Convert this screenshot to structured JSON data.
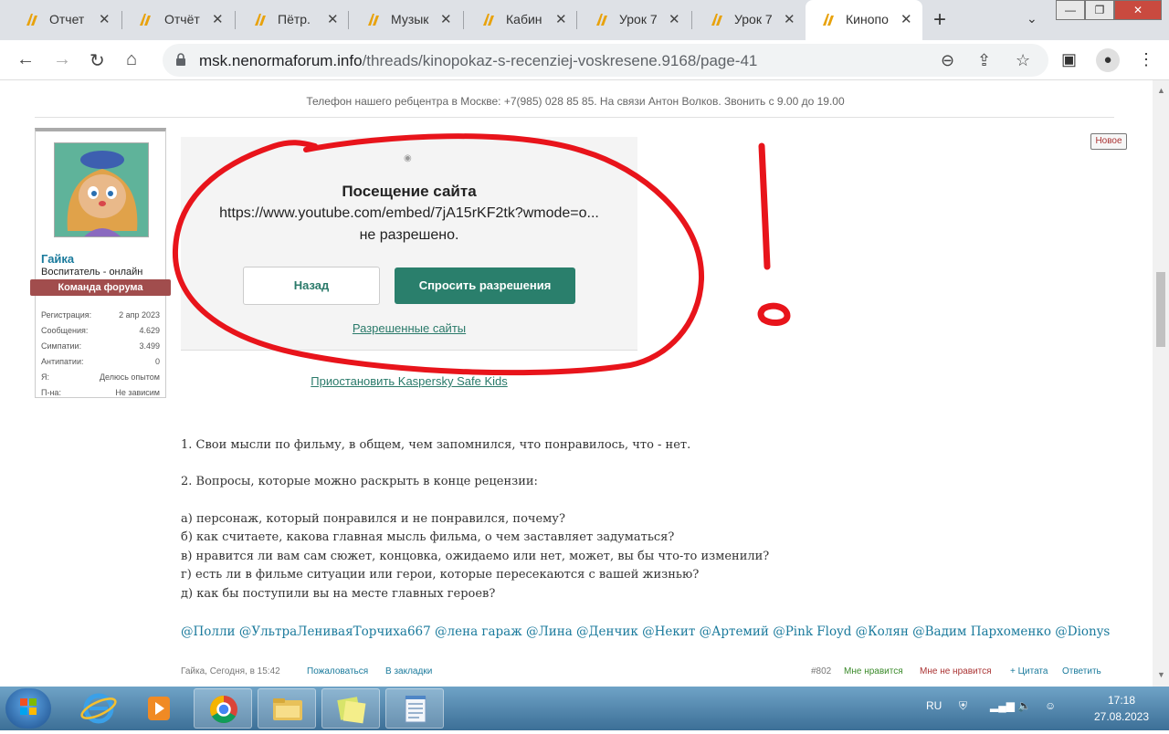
{
  "tabs": [
    {
      "title": "Отчет",
      "active": false
    },
    {
      "title": "Отчёт",
      "active": false
    },
    {
      "title": "Пётр.",
      "active": false
    },
    {
      "title": "Музык",
      "active": false
    },
    {
      "title": "Кабин",
      "active": false
    },
    {
      "title": "Урок 7",
      "active": false
    },
    {
      "title": "Урок 7",
      "active": false
    },
    {
      "title": "Кинопо",
      "active": true
    }
  ],
  "address": {
    "domain": "msk.nenormaforum.info",
    "path": "/threads/kinopokaz-s-recenziej-voskresene.9168/page-41"
  },
  "page": {
    "notice": "Телефон нашего ребцентра в Москве: +7(985) 028 85 85. На связи Антон Волков. Звонить с 9.00 до 19.00",
    "user": {
      "name": "Гайка",
      "role": "Воспитатель - онлайн",
      "team": "Команда форума",
      "stats": [
        {
          "label": "Регистрация:",
          "value": "2 апр 2023"
        },
        {
          "label": "Сообщения:",
          "value": "4.629"
        },
        {
          "label": "Симпатии:",
          "value": "3.499"
        },
        {
          "label": "Антипатии:",
          "value": "0"
        },
        {
          "label": "Я:",
          "value": "Делюсь опытом"
        },
        {
          "label": "П-на:",
          "value": "Не зависим"
        }
      ]
    },
    "block": {
      "heading": "Посещение сайта",
      "url": "https://www.youtube.com/embed/7jA15rKF2tk?wmode=o...",
      "denied": "не разрешено.",
      "back": "Назад",
      "ask": "Спросить разрешения",
      "allowed_sites": "Разрешенные сайты",
      "pause": "Приостановить Kaspersky Safe Kids"
    },
    "new_badge": "Новое",
    "post_lines": [
      "1. Свои мысли по фильму, в общем, чем запомнился, что понравилось, что - нет.",
      "2. Вопросы, которые можно раскрыть в конце рецензии:",
      "а) персонаж, который понравился и не понравился, почему?",
      "б) как считаете, какова главная мысль фильма, о чем заставляет задуматься?",
      "в) нравится ли вам сам сюжет, концовка, ожидаемо или нет, может, вы бы что-то изменили?",
      "г) есть ли в фильме ситуации или герои, которые пересекаются с вашей жизнью?",
      "д) как бы поступили вы на месте главных героев?"
    ],
    "mentions": "@Полли @УльтраЛениваяТорчиха667 @лена гараж @Лина @Денчик @Некит @Артемий @Pink Floyd @Колян @Вадим Пархоменко @Dionys",
    "footer": {
      "meta": "Гайка, Сегодня, в 15:42",
      "report": "Пожаловаться",
      "bookmark": "В закладки",
      "num": "#802",
      "like": "Мне нравится",
      "dislike": "Мне не нравится",
      "quote": "+ Цитата",
      "reply": "Ответить"
    }
  },
  "taskbar": {
    "lang": "RU",
    "time": "17:18",
    "date": "27.08.2023"
  },
  "colors": {
    "accent": "#2a7f6c",
    "link": "#1a7a9c",
    "ink": "#e8141b"
  }
}
